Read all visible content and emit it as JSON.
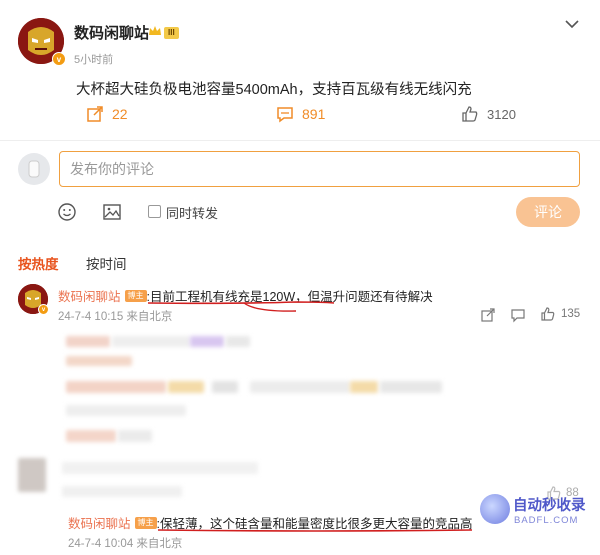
{
  "post": {
    "author": "数码闲聊站",
    "level_badge": "III",
    "time": "5小时前",
    "text": "大杯超大硅负极电池容量5400mAh，支持百瓦级有线无线闪充",
    "reposts": "22",
    "comments": "891",
    "likes": "3120"
  },
  "composer": {
    "placeholder": "发布你的评论",
    "forward_label": "同时转发",
    "submit_label": "评论"
  },
  "sort": {
    "hot": "按热度",
    "time": "按时间"
  },
  "comments": [
    {
      "author": "数码闲聊站",
      "tag": "博主",
      "text": ":目前工程机有线充是120W，但温升问题还有待解决",
      "meta": "24-7-4 10:15 来自北京",
      "likes": "135"
    },
    {
      "author": "数码闲聊站",
      "tag": "博主",
      "text": ":保轻薄，这个硅含量和能量密度比很多更大容量的竞品高",
      "meta": "24-7-4 10:04 来自北京",
      "likes": "88"
    }
  ],
  "watermark": {
    "title": "自动秒收录",
    "subtitle": "BADFL.COM"
  },
  "colors": {
    "accent": "#f08c28",
    "name_link": "#eb7350",
    "underline": "#d11f1f"
  }
}
